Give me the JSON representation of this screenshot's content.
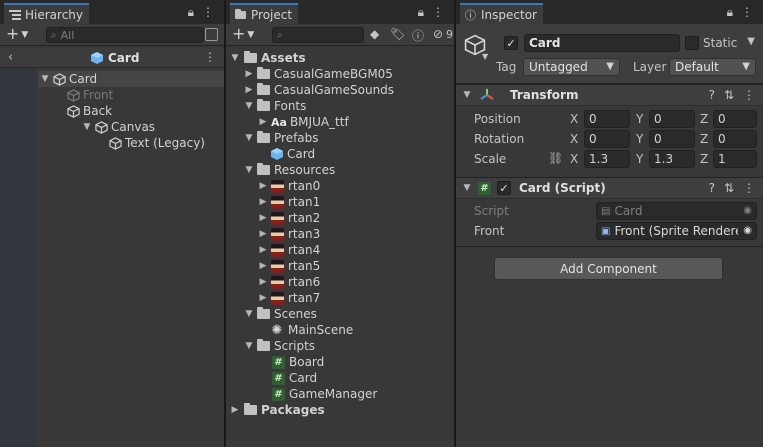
{
  "hierarchy": {
    "tab_label": "Hierarchy",
    "search_placeholder": "All",
    "breadcrumb": "Card",
    "items": [
      {
        "label": "Card"
      },
      {
        "label": "Front"
      },
      {
        "label": "Back"
      },
      {
        "label": "Canvas"
      },
      {
        "label": "Text (Legacy)"
      }
    ]
  },
  "project": {
    "tab_label": "Project",
    "badge_count": "9",
    "tree": {
      "assets": "Assets",
      "casual_bgm": "CasualGameBGM05",
      "casual_sounds": "CasualGameSounds",
      "fonts": "Fonts",
      "font_prefix": "Aa",
      "font_file": "BMJUA_ttf",
      "prefabs": "Prefabs",
      "prefab_card": "Card",
      "resources": "Resources",
      "sprites": [
        "rtan0",
        "rtan1",
        "rtan2",
        "rtan3",
        "rtan4",
        "rtan5",
        "rtan6",
        "rtan7"
      ],
      "scenes": "Scenes",
      "main_scene": "MainScene",
      "scripts": "Scripts",
      "script_files": [
        "Board",
        "Card",
        "GameManager"
      ],
      "packages": "Packages"
    }
  },
  "inspector": {
    "tab_label": "Inspector",
    "object_name": "Card",
    "static_label": "Static",
    "tag_label": "Tag",
    "tag_value": "Untagged",
    "layer_label": "Layer",
    "layer_value": "Default",
    "transform": {
      "title": "Transform",
      "position_label": "Position",
      "rotation_label": "Rotation",
      "scale_label": "Scale",
      "axes": {
        "x": "X",
        "y": "Y",
        "z": "Z"
      },
      "position": {
        "x": "0",
        "y": "0",
        "z": "0"
      },
      "rotation": {
        "x": "0",
        "y": "0",
        "z": "0"
      },
      "scale": {
        "x": "1.3",
        "y": "1.3",
        "z": "1"
      }
    },
    "card_script": {
      "title": "Card (Script)",
      "script_label": "Script",
      "script_value": "Card",
      "front_label": "Front",
      "front_value": "Front (Sprite Renderer)"
    },
    "add_component_label": "Add Component"
  },
  "colors": {
    "accent": "#3a79bb",
    "panel_bg": "#383838",
    "tab_bg": "#282828"
  }
}
